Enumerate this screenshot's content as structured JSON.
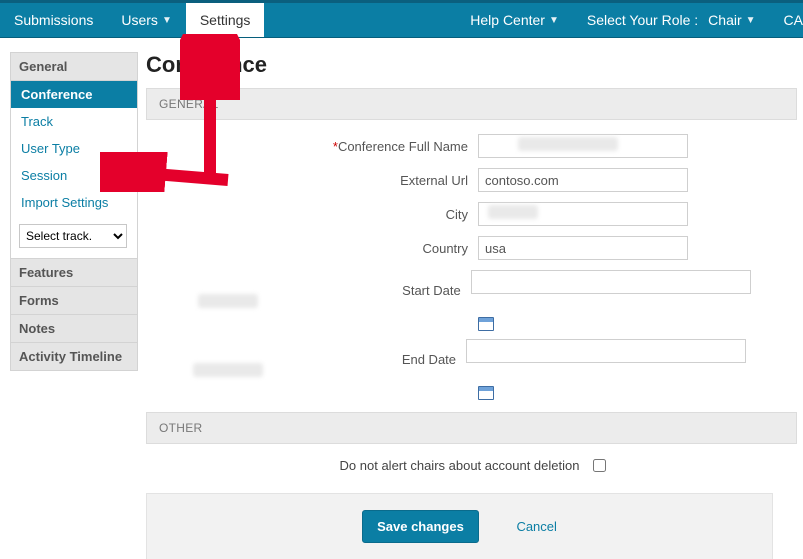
{
  "nav": {
    "left": [
      {
        "label": "Submissions",
        "dropdown": false
      },
      {
        "label": "Users",
        "dropdown": true
      },
      {
        "label": "Settings",
        "dropdown": false,
        "active": true
      }
    ],
    "right": {
      "help": "Help Center",
      "role_label": "Select Your Role :",
      "role_value": "Chair",
      "overflow": "CA"
    }
  },
  "sidebar": {
    "sections": [
      {
        "title": "General",
        "open": true,
        "items": [
          {
            "label": "Conference",
            "active": true
          },
          {
            "label": "Track"
          },
          {
            "label": "User Type"
          },
          {
            "label": "Session"
          },
          {
            "label": "Import Settings"
          }
        ]
      },
      {
        "title": "Features"
      },
      {
        "title": "Forms"
      },
      {
        "title": "Notes"
      },
      {
        "title": "Activity Timeline"
      }
    ],
    "track_select": "Select track."
  },
  "page": {
    "title": "Conference",
    "section_general": "GENERAL",
    "section_other": "OTHER",
    "fields": {
      "full_name_label": "Conference Full Name",
      "full_name_value": "",
      "external_url_label": "External Url",
      "external_url_value": "contoso.com",
      "city_label": "City",
      "city_value": "",
      "country_label": "Country",
      "country_value": "usa",
      "start_date_label": "Start Date",
      "start_date_value": "",
      "end_date_label": "End Date",
      "end_date_value": ""
    },
    "other": {
      "no_alert_label": "Do not alert chairs about account deletion",
      "no_alert_checked": false
    },
    "actions": {
      "save": "Save changes",
      "cancel": "Cancel"
    }
  }
}
